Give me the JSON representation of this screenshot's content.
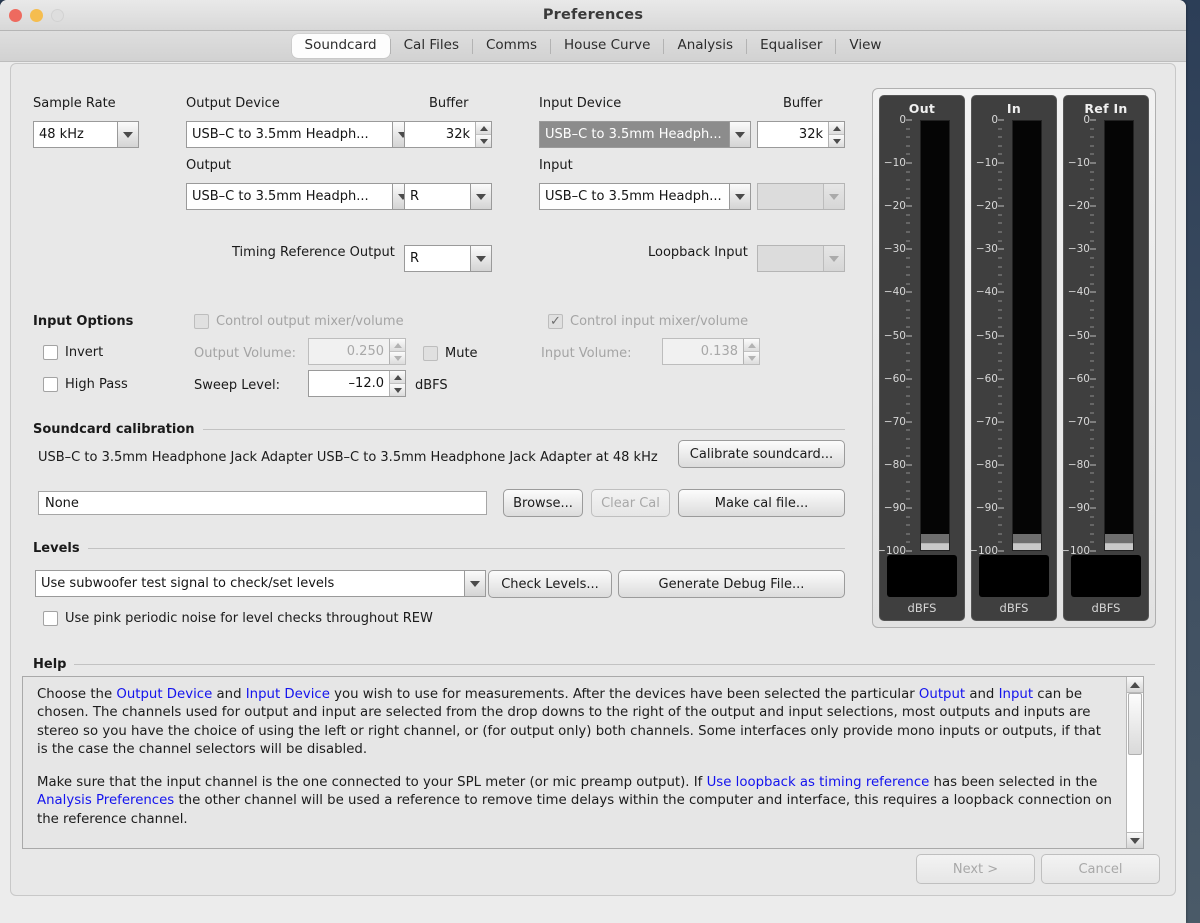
{
  "window": {
    "title": "Preferences"
  },
  "tabs": [
    {
      "label": "Soundcard",
      "active": true
    },
    {
      "label": "Cal Files",
      "active": false
    },
    {
      "label": "Comms",
      "active": false
    },
    {
      "label": "House Curve",
      "active": false
    },
    {
      "label": "Analysis",
      "active": false
    },
    {
      "label": "Equaliser",
      "active": false
    },
    {
      "label": "View",
      "active": false
    }
  ],
  "devices": {
    "sample_rate_label": "Sample Rate",
    "sample_rate_value": "48 kHz",
    "output_device_label": "Output Device",
    "output_device_value": "USB–C to 3.5mm Headph...",
    "output_buffer_label": "Buffer",
    "output_buffer_value": "32k",
    "output_label": "Output",
    "output_value": "USB–C to 3.5mm Headph...",
    "output_channel_value": "R",
    "input_device_label": "Input Device",
    "input_device_value": "USB–C to 3.5mm Headph...",
    "input_buffer_label": "Buffer",
    "input_buffer_value": "32k",
    "input_label": "Input",
    "input_value": "USB–C to 3.5mm Headph...",
    "input_channel_value": "",
    "timing_ref_label": "Timing Reference Output",
    "timing_ref_value": "R",
    "loopback_label": "Loopback Input",
    "loopback_value": ""
  },
  "input_options": {
    "title": "Input Options",
    "invert_label": "Invert",
    "invert_checked": false,
    "high_pass_label": "High Pass",
    "high_pass_checked": false,
    "control_output_label": "Control output mixer/volume",
    "control_output_checked": false,
    "control_input_label": "Control input mixer/volume",
    "control_input_checked": true,
    "control_input_mark": "✓",
    "output_volume_label": "Output Volume:",
    "output_volume_value": "0.250",
    "mute_label": "Mute",
    "mute_checked": false,
    "input_volume_label": "Input Volume:",
    "input_volume_value": "0.138",
    "sweep_level_label": "Sweep Level:",
    "sweep_level_value": "–12.0",
    "sweep_level_units": "dBFS"
  },
  "calibration": {
    "title": "Soundcard calibration",
    "description": "USB–C to 3.5mm Headphone Jack Adapter USB–C to 3.5mm Headphone Jack Adapter at 48 kHz",
    "calibrate_button": "Calibrate soundcard...",
    "cal_file_value": "None",
    "browse_button": "Browse...",
    "clear_cal_button": "Clear Cal",
    "make_cal_button": "Make cal file..."
  },
  "levels": {
    "title": "Levels",
    "test_signal_value": "Use subwoofer test signal to check/set levels",
    "check_levels_button": "Check Levels...",
    "generate_debug_button": "Generate Debug File...",
    "pink_noise_label": "Use pink periodic noise for level checks throughout REW",
    "pink_noise_checked": false
  },
  "meters": {
    "columns": [
      {
        "title": "Out",
        "units": "dBFS"
      },
      {
        "title": "In",
        "units": "dBFS"
      },
      {
        "title": "Ref In",
        "units": "dBFS"
      }
    ],
    "scale_labels": [
      "0",
      "−10",
      "−20",
      "−30",
      "−40",
      "−50",
      "−60",
      "−70",
      "−80",
      "−90",
      "−100"
    ],
    "scale_min": -100,
    "scale_max": 0
  },
  "help": {
    "title": "Help",
    "paragraph1": [
      {
        "t": "Choose the "
      },
      {
        "t": "Output Device",
        "link": true
      },
      {
        "t": " and "
      },
      {
        "t": "Input Device",
        "link": true
      },
      {
        "t": " you wish to use for measurements. After the devices have been selected the particular "
      },
      {
        "t": "Output",
        "link": true
      },
      {
        "t": " and "
      },
      {
        "t": "Input",
        "link": true
      },
      {
        "t": " can be chosen. The channels used for output and input are selected from the drop downs to the right of the output and input selections, most outputs and inputs are stereo so you have the choice of using the left or right channel, or (for output only) both channels. Some interfaces only provide mono inputs or outputs, if that is the case the channel selectors will be disabled."
      }
    ],
    "paragraph2": [
      {
        "t": "Make sure that the input channel is the one connected to your SPL meter (or mic preamp output). If "
      },
      {
        "t": "Use loopback as timing reference",
        "link": true
      },
      {
        "t": " has been selected in the "
      },
      {
        "t": "Analysis Preferences",
        "link": true
      },
      {
        "t": " the other channel will be used a reference to remove time delays within the computer and interface, this requires a loopback connection on the reference channel."
      }
    ]
  },
  "footer": {
    "next_button": "Next >",
    "cancel_button": "Cancel"
  },
  "colors": {
    "link": "#1313ee",
    "accent": "#8c8c8c"
  }
}
